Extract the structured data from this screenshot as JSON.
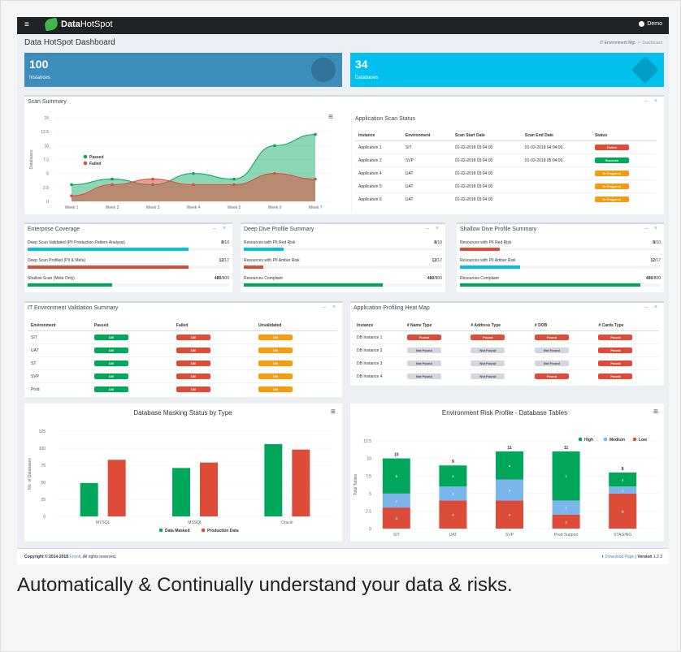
{
  "navbar": {
    "logo_bold": "Data",
    "logo_rest": "HotSpot",
    "user_name": "Demo",
    "toggle_glyph": "≡"
  },
  "header": {
    "page_title": "Data HotSpot Dashboard",
    "breadcrumb": [
      "IT Environment Mgt",
      "Dashboard"
    ]
  },
  "kpis": [
    {
      "value": "100",
      "label": "Instances",
      "color": "#3c8dbc",
      "icon": "globe-icon"
    },
    {
      "value": "34",
      "label": "Databases",
      "color": "#00c0ef",
      "icon": "cube-icon"
    }
  ],
  "tools_glyph": "– ×",
  "menu_glyph": "≡",
  "scan_summary": {
    "title": "Scan Summary",
    "chart_data": {
      "type": "area",
      "x": [
        "Week 1",
        "Week 2",
        "Week 3",
        "Week 4",
        "Week 5",
        "Week 6",
        "Week 7"
      ],
      "ylabel": "Databases",
      "yticks": [
        "0",
        "2.5",
        "5",
        "7.5",
        "10",
        "12.5",
        "15"
      ],
      "ylim": [
        0,
        15
      ],
      "legend_position": "left-middle",
      "series": [
        {
          "name": "Passed",
          "values": [
            3,
            4,
            3,
            5,
            4,
            10,
            12
          ],
          "color": "#00a65a"
        },
        {
          "name": "Failed",
          "values": [
            1,
            3,
            4,
            3,
            3,
            5,
            4
          ],
          "color": "#dd4b39"
        }
      ]
    }
  },
  "app_scan": {
    "title": "Application Scan Status",
    "columns": [
      "Instance",
      "Environment",
      "Scan Start Date",
      "Scan End Date",
      "Status"
    ],
    "rows": [
      {
        "instance": "Application 1",
        "env": "SIT",
        "start": "01-02-2018 03:04:00",
        "end": "01-02-2018 04:04:00",
        "status": "Failed",
        "color": "#dd4b39"
      },
      {
        "instance": "Application 2",
        "env": "SVP",
        "start": "01-02-2018 03:04:00",
        "end": "01-02-2018 05:04:00",
        "status": "Success",
        "color": "#00a65a"
      },
      {
        "instance": "Application 4",
        "env": "UAT",
        "start": "01-02-2018 03:04:00",
        "end": "",
        "status": "In Progress",
        "color": "#f39c12"
      },
      {
        "instance": "Application 5",
        "env": "UAT",
        "start": "01-02-2018 03:04:00",
        "end": "",
        "status": "In Progress",
        "color": "#f39c12"
      },
      {
        "instance": "Application 6",
        "env": "UAT",
        "start": "01-02-2018 03:04:00",
        "end": "",
        "status": "In Progress",
        "color": "#f39c12"
      }
    ]
  },
  "enterprise": {
    "title": "Enterprise Coverage",
    "rows": [
      {
        "label": "Deep Scan Validated (PII Production Pattern Analysis)",
        "num": "8",
        "den": "/10",
        "pct": 0.8,
        "color": "#00c0ef"
      },
      {
        "label": "Deep Scan Profiled (PII & Meta)",
        "num": "12",
        "den": "/17",
        "pct": 0.8,
        "color": "#dd4b39"
      },
      {
        "label": "Shallow Scan (Meta Only)",
        "num": "480",
        "den": "/800",
        "pct": 0.42,
        "color": "#00a65a"
      }
    ]
  },
  "deep_dive": {
    "title": "Deep Dive Profile Summary",
    "rows": [
      {
        "label": "Resources with PII Red Risk",
        "num": "8",
        "den": "/10",
        "pct": 0.2,
        "color": "#00c0ef"
      },
      {
        "label": "Resources with PII Amber Risk",
        "num": "12",
        "den": "/17",
        "pct": 0.1,
        "color": "#dd4b39"
      },
      {
        "label": "Resources Compliant",
        "num": "480",
        "den": "/800",
        "pct": 0.7,
        "color": "#00a65a"
      }
    ]
  },
  "shallow_dive": {
    "title": "Shallow Dive Profile Summary",
    "rows": [
      {
        "label": "Resources with PII Red Risk",
        "num": "8",
        "den": "/10",
        "pct": 0.2,
        "color": "#dd4b39"
      },
      {
        "label": "Resources with PII Amber Risk",
        "num": "12",
        "den": "/17",
        "pct": 0.3,
        "color": "#00c0ef"
      },
      {
        "label": "Resources Compliant",
        "num": "480",
        "den": "/800",
        "pct": 0.9,
        "color": "#00a65a"
      }
    ]
  },
  "it_env": {
    "title": "IT Environment Validation Summary",
    "columns": [
      "Environment",
      "Passed",
      "Failed",
      "Unvalidated"
    ],
    "badge_value": "100",
    "rows": [
      "SIT",
      "UAT",
      "ST",
      "SVP",
      "Prod"
    ]
  },
  "heatmap": {
    "title": "Application Profiling Heat Map",
    "columns": [
      "Instance",
      "# Name Type",
      "# Address Type",
      "# DOB",
      "# Cards Type"
    ],
    "rows": [
      {
        "instance": "DB Instance 1",
        "cells": [
          "Found",
          "Found",
          "Found",
          "Found"
        ]
      },
      {
        "instance": "DB Instance 2",
        "cells": [
          "Not Found",
          "Not Found",
          "Not Found",
          "Found"
        ]
      },
      {
        "instance": "DB Instance 3",
        "cells": [
          "Not Found",
          "Not Found",
          "Not Found",
          "Found"
        ]
      },
      {
        "instance": "DB Instance 4",
        "cells": [
          "Not Found",
          "Not Found",
          "Found",
          "Found"
        ]
      }
    ]
  },
  "masking": {
    "chart_data": {
      "type": "bar",
      "title": "Database Masking Status by Type",
      "categories": [
        "MYSQL",
        "MSSQL",
        "Oracle"
      ],
      "ylabel": "No. of Databases",
      "yticks": [
        "0",
        "25",
        "50",
        "75",
        "100",
        "125"
      ],
      "ylim": [
        0,
        125
      ],
      "legend_position": "bottom",
      "series": [
        {
          "name": "Data Masked",
          "values": [
            49,
            71,
            106
          ],
          "color": "#00a65a"
        },
        {
          "name": "Production Data",
          "values": [
            83,
            79,
            98
          ],
          "color": "#dd4b39"
        }
      ]
    }
  },
  "risk": {
    "chart_data": {
      "type": "bar",
      "stacked": true,
      "title": "Environment Risk Profile - Database Tables",
      "categories": [
        "SIT",
        "UAT",
        "SVP",
        "Prod-Support",
        "STAGING"
      ],
      "ylabel": "Total Tables",
      "yticks": [
        "0",
        "2.5",
        "5",
        "7.5",
        "10",
        "12.5"
      ],
      "ylim": [
        0,
        12.5
      ],
      "totals": [
        "10",
        "9",
        "11",
        "11",
        "8"
      ],
      "legend_position": "top-right",
      "series": [
        {
          "name": "Low",
          "values": [
            3,
            4,
            4,
            2,
            5
          ],
          "labels": [
            "3",
            "4",
            "4",
            "2",
            "5"
          ],
          "color": "#dd4b39"
        },
        {
          "name": "Medium",
          "values": [
            2,
            2,
            3,
            2,
            1
          ],
          "labels": [
            "2",
            "2",
            "3",
            "2",
            "1"
          ],
          "color": "#7cb5ec"
        },
        {
          "name": "High",
          "values": [
            5,
            3,
            4,
            7,
            2
          ],
          "labels": [
            "5",
            "3",
            "4",
            "7",
            "2"
          ],
          "color": "#00a65a"
        }
      ],
      "legend_order": [
        "High",
        "Medium",
        "Low"
      ]
    }
  },
  "footer": {
    "copyright": "Copyright © 2014-2018",
    "company": "Envolt",
    "rights": ". All rights reserved.",
    "download": "Download Page",
    "version_label": "Version",
    "version": "1.2.3"
  },
  "tagline": "Automatically & Continually understand your data & risks."
}
